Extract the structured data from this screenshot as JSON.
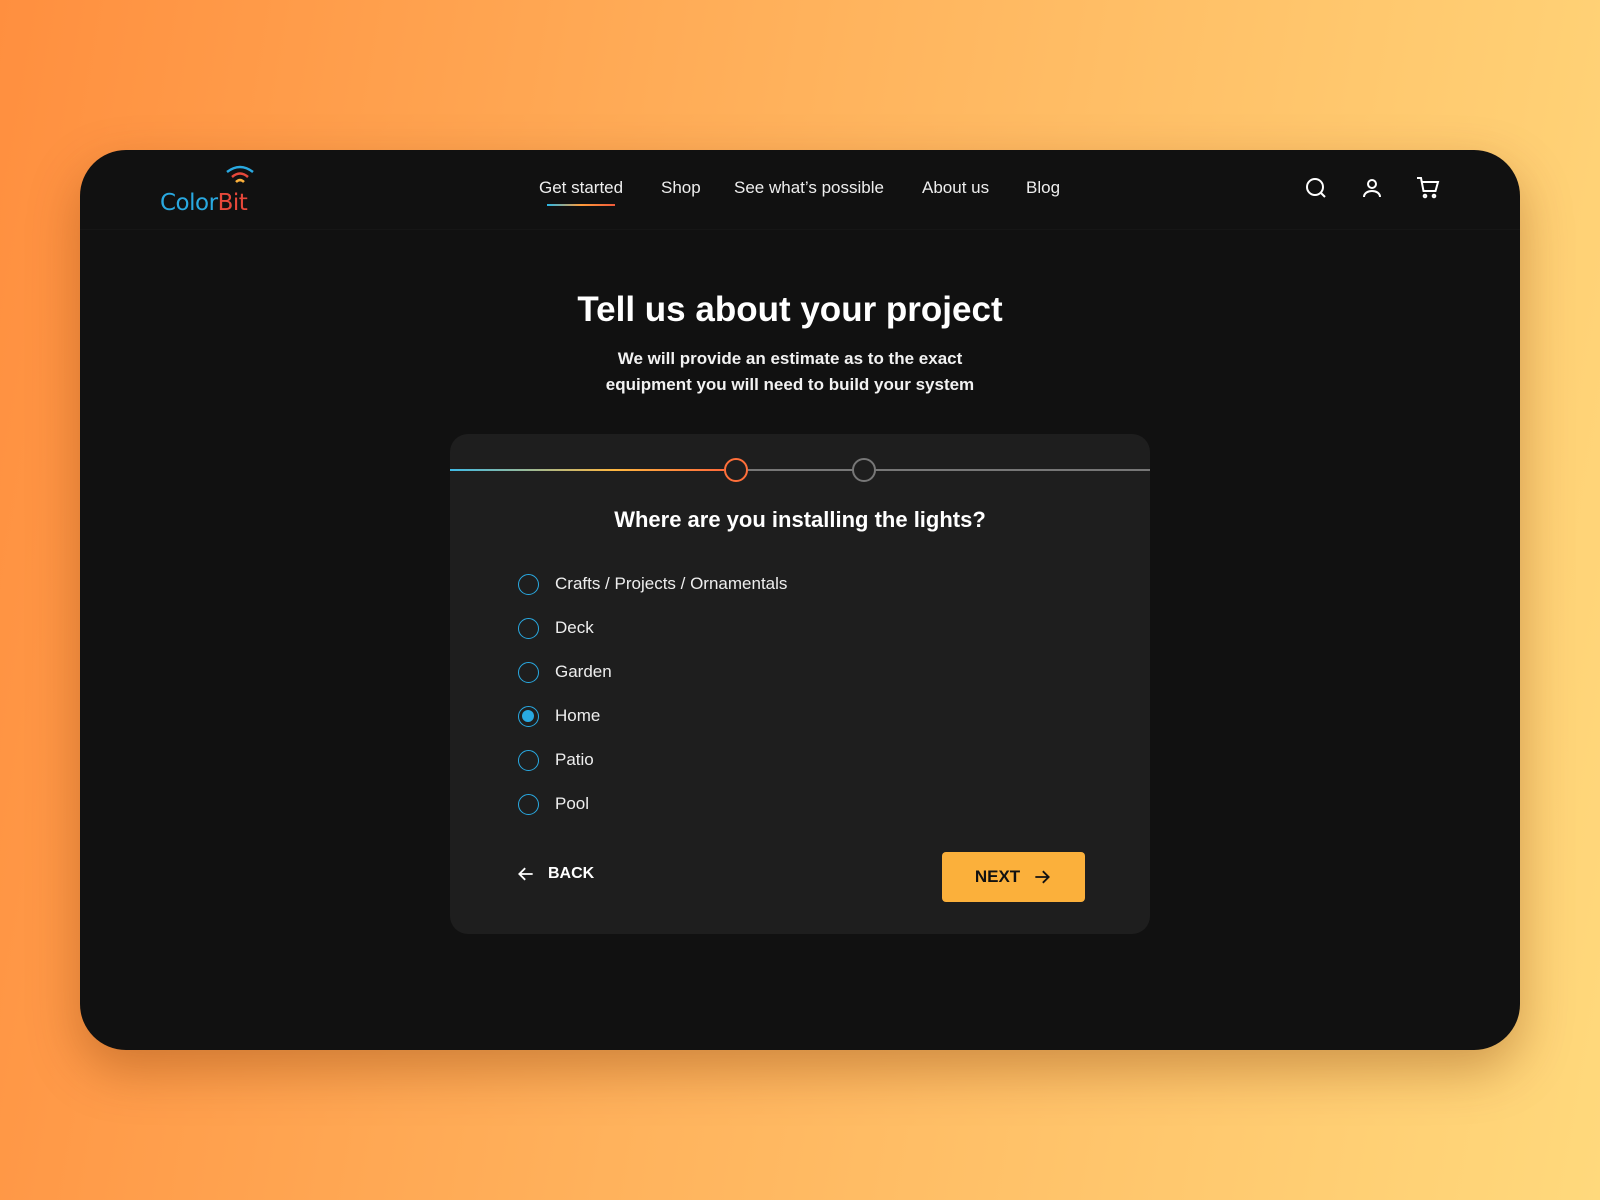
{
  "logo": {
    "part1": "Color",
    "part2": "Bit"
  },
  "nav": [
    "Get started",
    "Shop",
    "See what’s possible",
    "About us",
    "Blog"
  ],
  "hero": {
    "title": "Tell us about your project",
    "subtitle_line1": "We will provide an estimate as to the exact",
    "subtitle_line2": "equipment you will need to build your system"
  },
  "form": {
    "question": "Where are you installing the lights?",
    "progress_step": 1,
    "total_steps": 2,
    "options": [
      "Crafts / Projects / Ornamentals",
      "Deck",
      "Garden",
      "Home",
      "Patio",
      "Pool"
    ],
    "selected": "Home",
    "back_label": "BACK",
    "next_label": "NEXT"
  },
  "colors": {
    "accent": "#29a9e1",
    "cta": "#fbb03b",
    "step_active": "#ff6f3a"
  }
}
